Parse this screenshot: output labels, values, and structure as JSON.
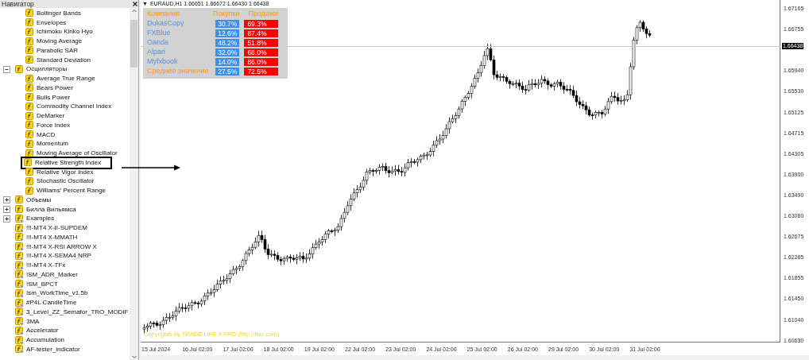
{
  "navigator": {
    "title": "Навигатор",
    "tree": [
      {
        "children": [
          {
            "label": "Bollinger Bands",
            "kind": "builtin",
            "highlighted": false
          },
          {
            "label": "Envelopes",
            "kind": "builtin",
            "highlighted": false
          },
          {
            "label": "Ichimoku Kinko Hyo",
            "kind": "builtin",
            "highlighted": false
          },
          {
            "label": "Moving Average",
            "kind": "builtin",
            "highlighted": false
          },
          {
            "label": "Parabolic SAR",
            "kind": "builtin",
            "highlighted": false
          },
          {
            "label": "Standard Deviation",
            "kind": "builtin",
            "highlighted": false
          }
        ]
      },
      {
        "label": "Осцилляторы",
        "kind": "builtin",
        "expanded": true,
        "children": [
          {
            "label": "Average True Range",
            "kind": "builtin",
            "highlighted": false
          },
          {
            "label": "Bears Power",
            "kind": "builtin",
            "highlighted": false
          },
          {
            "label": "Bulls Power",
            "kind": "builtin",
            "highlighted": false
          },
          {
            "label": "Commodity Channel Index",
            "kind": "builtin",
            "highlighted": false
          },
          {
            "label": "DeMarker",
            "kind": "builtin",
            "highlighted": false
          },
          {
            "label": "Force Index",
            "kind": "builtin",
            "highlighted": false
          },
          {
            "label": "MACD",
            "kind": "builtin",
            "highlighted": false
          },
          {
            "label": "Momentum",
            "kind": "builtin",
            "highlighted": false
          },
          {
            "label": "Moving Average of Oscillator",
            "kind": "builtin",
            "highlighted": false
          },
          {
            "label": "Relative Strength Index",
            "kind": "builtin",
            "highlighted": true
          },
          {
            "label": "Relative Vigor Index",
            "kind": "builtin",
            "highlighted": false
          },
          {
            "label": "Stochastic Oscillator",
            "kind": "builtin",
            "highlighted": false
          },
          {
            "label": "Williams' Percent Range",
            "kind": "builtin",
            "highlighted": false
          }
        ]
      },
      {
        "label": "Объемы",
        "kind": "builtin",
        "expanded": false
      },
      {
        "label": "Билла Вильямса",
        "kind": "builtin",
        "expanded": false
      },
      {
        "label": "Examples",
        "kind": "custom",
        "expanded": false
      },
      {
        "label": "!!!-MT4 X-II-SUPDEM",
        "kind": "custom"
      },
      {
        "label": "!!!-MT4 X-MMATH",
        "kind": "custom"
      },
      {
        "label": "!!!-MT4 X-RSI ARROW X",
        "kind": "custom"
      },
      {
        "label": "!!!-MT4 X-SEMA4 NRP",
        "kind": "custom"
      },
      {
        "label": "!!!-MT4 X-TFx",
        "kind": "custom"
      },
      {
        "label": "!SM_ADR_Marker",
        "kind": "custom"
      },
      {
        "label": "!SM_BPCT",
        "kind": "custom"
      },
      {
        "label": "!sm_WorkTime_v1.5b",
        "kind": "custom"
      },
      {
        "label": "#P4L CandleTime",
        "kind": "custom"
      },
      {
        "label": "3_Level_ZZ_Semafor_TRO_MODIF",
        "kind": "custom"
      },
      {
        "label": "3MA",
        "kind": "custom"
      },
      {
        "label": "Accelerator",
        "kind": "custom"
      },
      {
        "label": "Accumulation",
        "kind": "custom"
      },
      {
        "label": "AF-tester_indicator",
        "kind": "custom"
      }
    ]
  },
  "chart": {
    "title_marker": "▼",
    "title": "EURAUD,H1  1.66651 1.66672 1.66430 1.66438",
    "sentiment": {
      "columns": [
        "Компания",
        "Покупки",
        "Продажи"
      ],
      "rows": [
        {
          "name": "DukasCopy",
          "kind": "broker",
          "buy": {
            "text": "30.7%"
          },
          "sell": {
            "text": "69.3%"
          }
        },
        {
          "name": "FXBlue",
          "kind": "broker",
          "buy": {
            "text": "12.6%"
          },
          "sell": {
            "text": "87.4%"
          }
        },
        {
          "name": "Oanda",
          "kind": "broker",
          "buy": {
            "text": "48.2%"
          },
          "sell": {
            "text": "51.8%"
          }
        },
        {
          "name": "Alpari",
          "kind": "broker",
          "buy": {
            "text": "32.0%"
          },
          "sell": {
            "text": "68.0%"
          }
        },
        {
          "name": "Myfxbook",
          "kind": "broker",
          "buy": {
            "text": "14.0%"
          },
          "sell": {
            "text": "86.0%"
          }
        },
        {
          "name": "Среднее значение",
          "kind": "average",
          "buy": {
            "text": "27.5%"
          },
          "sell": {
            "text": "72.5%"
          }
        }
      ]
    },
    "price_axis": [
      {
        "text": "1.67165",
        "kind": "tick"
      },
      {
        "text": "1.66755",
        "kind": "tick"
      },
      {
        "text": "1.66438",
        "kind": "current"
      },
      {
        "text": "1.65940",
        "kind": "tick"
      },
      {
        "text": "1.65530",
        "kind": "tick"
      },
      {
        "text": "1.65125",
        "kind": "tick"
      },
      {
        "text": "1.64715",
        "kind": "tick"
      },
      {
        "text": "1.64305",
        "kind": "tick"
      },
      {
        "text": "1.63900",
        "kind": "tick"
      },
      {
        "text": "1.63490",
        "kind": "tick"
      },
      {
        "text": "1.63080",
        "kind": "tick"
      },
      {
        "text": "1.62675",
        "kind": "tick"
      },
      {
        "text": "1.62265",
        "kind": "tick"
      },
      {
        "text": "1.61855",
        "kind": "tick"
      },
      {
        "text": "1.61450",
        "kind": "tick"
      },
      {
        "text": "1.61040",
        "kind": "tick"
      },
      {
        "text": "1.60630",
        "kind": "tick"
      }
    ],
    "time_axis": [
      "15 Jul 2024",
      "16 Jul 02:00",
      "17 Jul 02:00",
      "18 Jul 02:00",
      "19 Jul 02:00",
      "22 Jul 02:00",
      "23 Jul 02:00",
      "24 Jul 02:00",
      "25 Jul 02:00",
      "26 Jul 02:00",
      "29 Jul 02:00",
      "30 Jul 02:00",
      "31 Jul 02:00"
    ],
    "copyright": "Copyrights by TRADE LIKE A PRO (http://tlap.com)"
  }
}
